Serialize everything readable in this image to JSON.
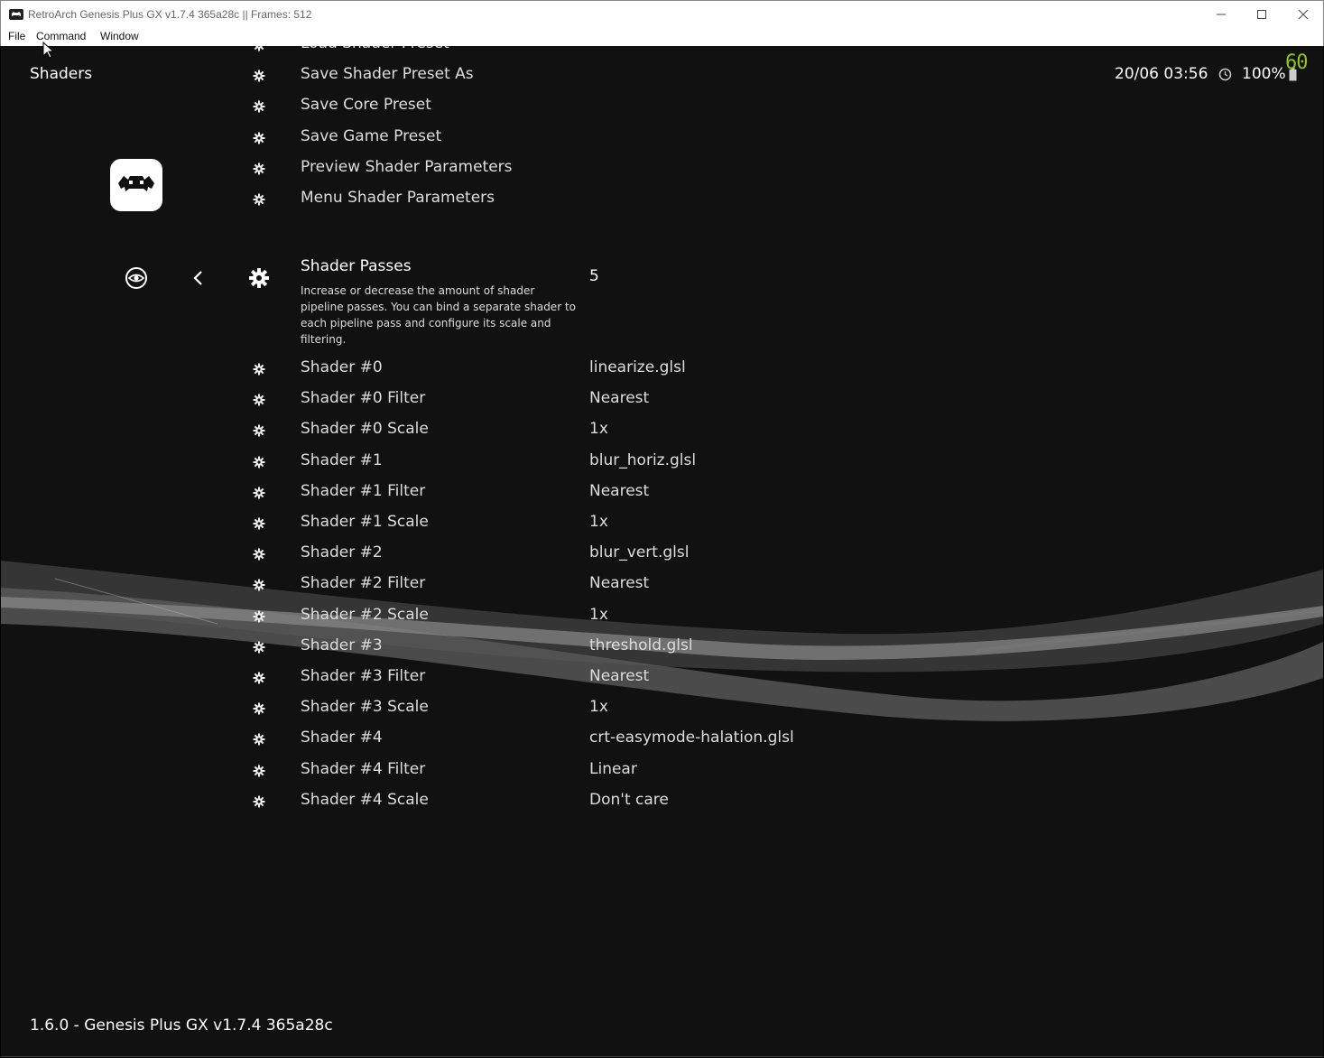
{
  "window": {
    "title": "RetroArch Genesis Plus GX v1.7.4 365a28c || Frames: 512"
  },
  "menubar": {
    "items": [
      "File",
      "Command",
      "Window"
    ]
  },
  "header": {
    "title": "Shaders",
    "datetime": "20/06 03:56",
    "battery": "100%",
    "fps": "60"
  },
  "top_items": [
    {
      "label": "Load Shader Preset"
    },
    {
      "label": "Save Shader Preset As"
    },
    {
      "label": "Save Core Preset"
    },
    {
      "label": "Save Game Preset"
    },
    {
      "label": "Preview Shader Parameters"
    },
    {
      "label": "Menu Shader Parameters"
    }
  ],
  "selected": {
    "label": "Shader Passes",
    "value": "5",
    "description": "Increase or decrease the amount of shader pipeline passes. You can bind a separate shader to each pipeline pass and configure its scale and filtering."
  },
  "items": [
    {
      "label": "Shader #0",
      "value": "linearize.glsl"
    },
    {
      "label": "Shader #0 Filter",
      "value": "Nearest"
    },
    {
      "label": "Shader #0 Scale",
      "value": "1x"
    },
    {
      "label": "Shader #1",
      "value": "blur_horiz.glsl"
    },
    {
      "label": "Shader #1 Filter",
      "value": "Nearest"
    },
    {
      "label": "Shader #1 Scale",
      "value": "1x"
    },
    {
      "label": "Shader #2",
      "value": "blur_vert.glsl"
    },
    {
      "label": "Shader #2 Filter",
      "value": "Nearest"
    },
    {
      "label": "Shader #2 Scale",
      "value": "1x"
    },
    {
      "label": "Shader #3",
      "value": "threshold.glsl"
    },
    {
      "label": "Shader #3 Filter",
      "value": "Nearest"
    },
    {
      "label": "Shader #3 Scale",
      "value": "1x"
    },
    {
      "label": "Shader #4",
      "value": "crt-easymode-halation.glsl"
    },
    {
      "label": "Shader #4 Filter",
      "value": "Linear"
    },
    {
      "label": "Shader #4 Scale",
      "value": "Don't care"
    }
  ],
  "footer": {
    "version": "1.6.0 - Genesis Plus GX v1.7.4 365a28c"
  },
  "icons": {
    "sidebar": [
      "retroarch-logo-icon",
      "eye-icon",
      "back-arrow-icon",
      "settings-gear-icon"
    ],
    "status": [
      "clock-icon",
      "battery-icon"
    ]
  },
  "colors": {
    "background": "#111111",
    "fps": "#8fc31f",
    "text": "#ffffff"
  }
}
